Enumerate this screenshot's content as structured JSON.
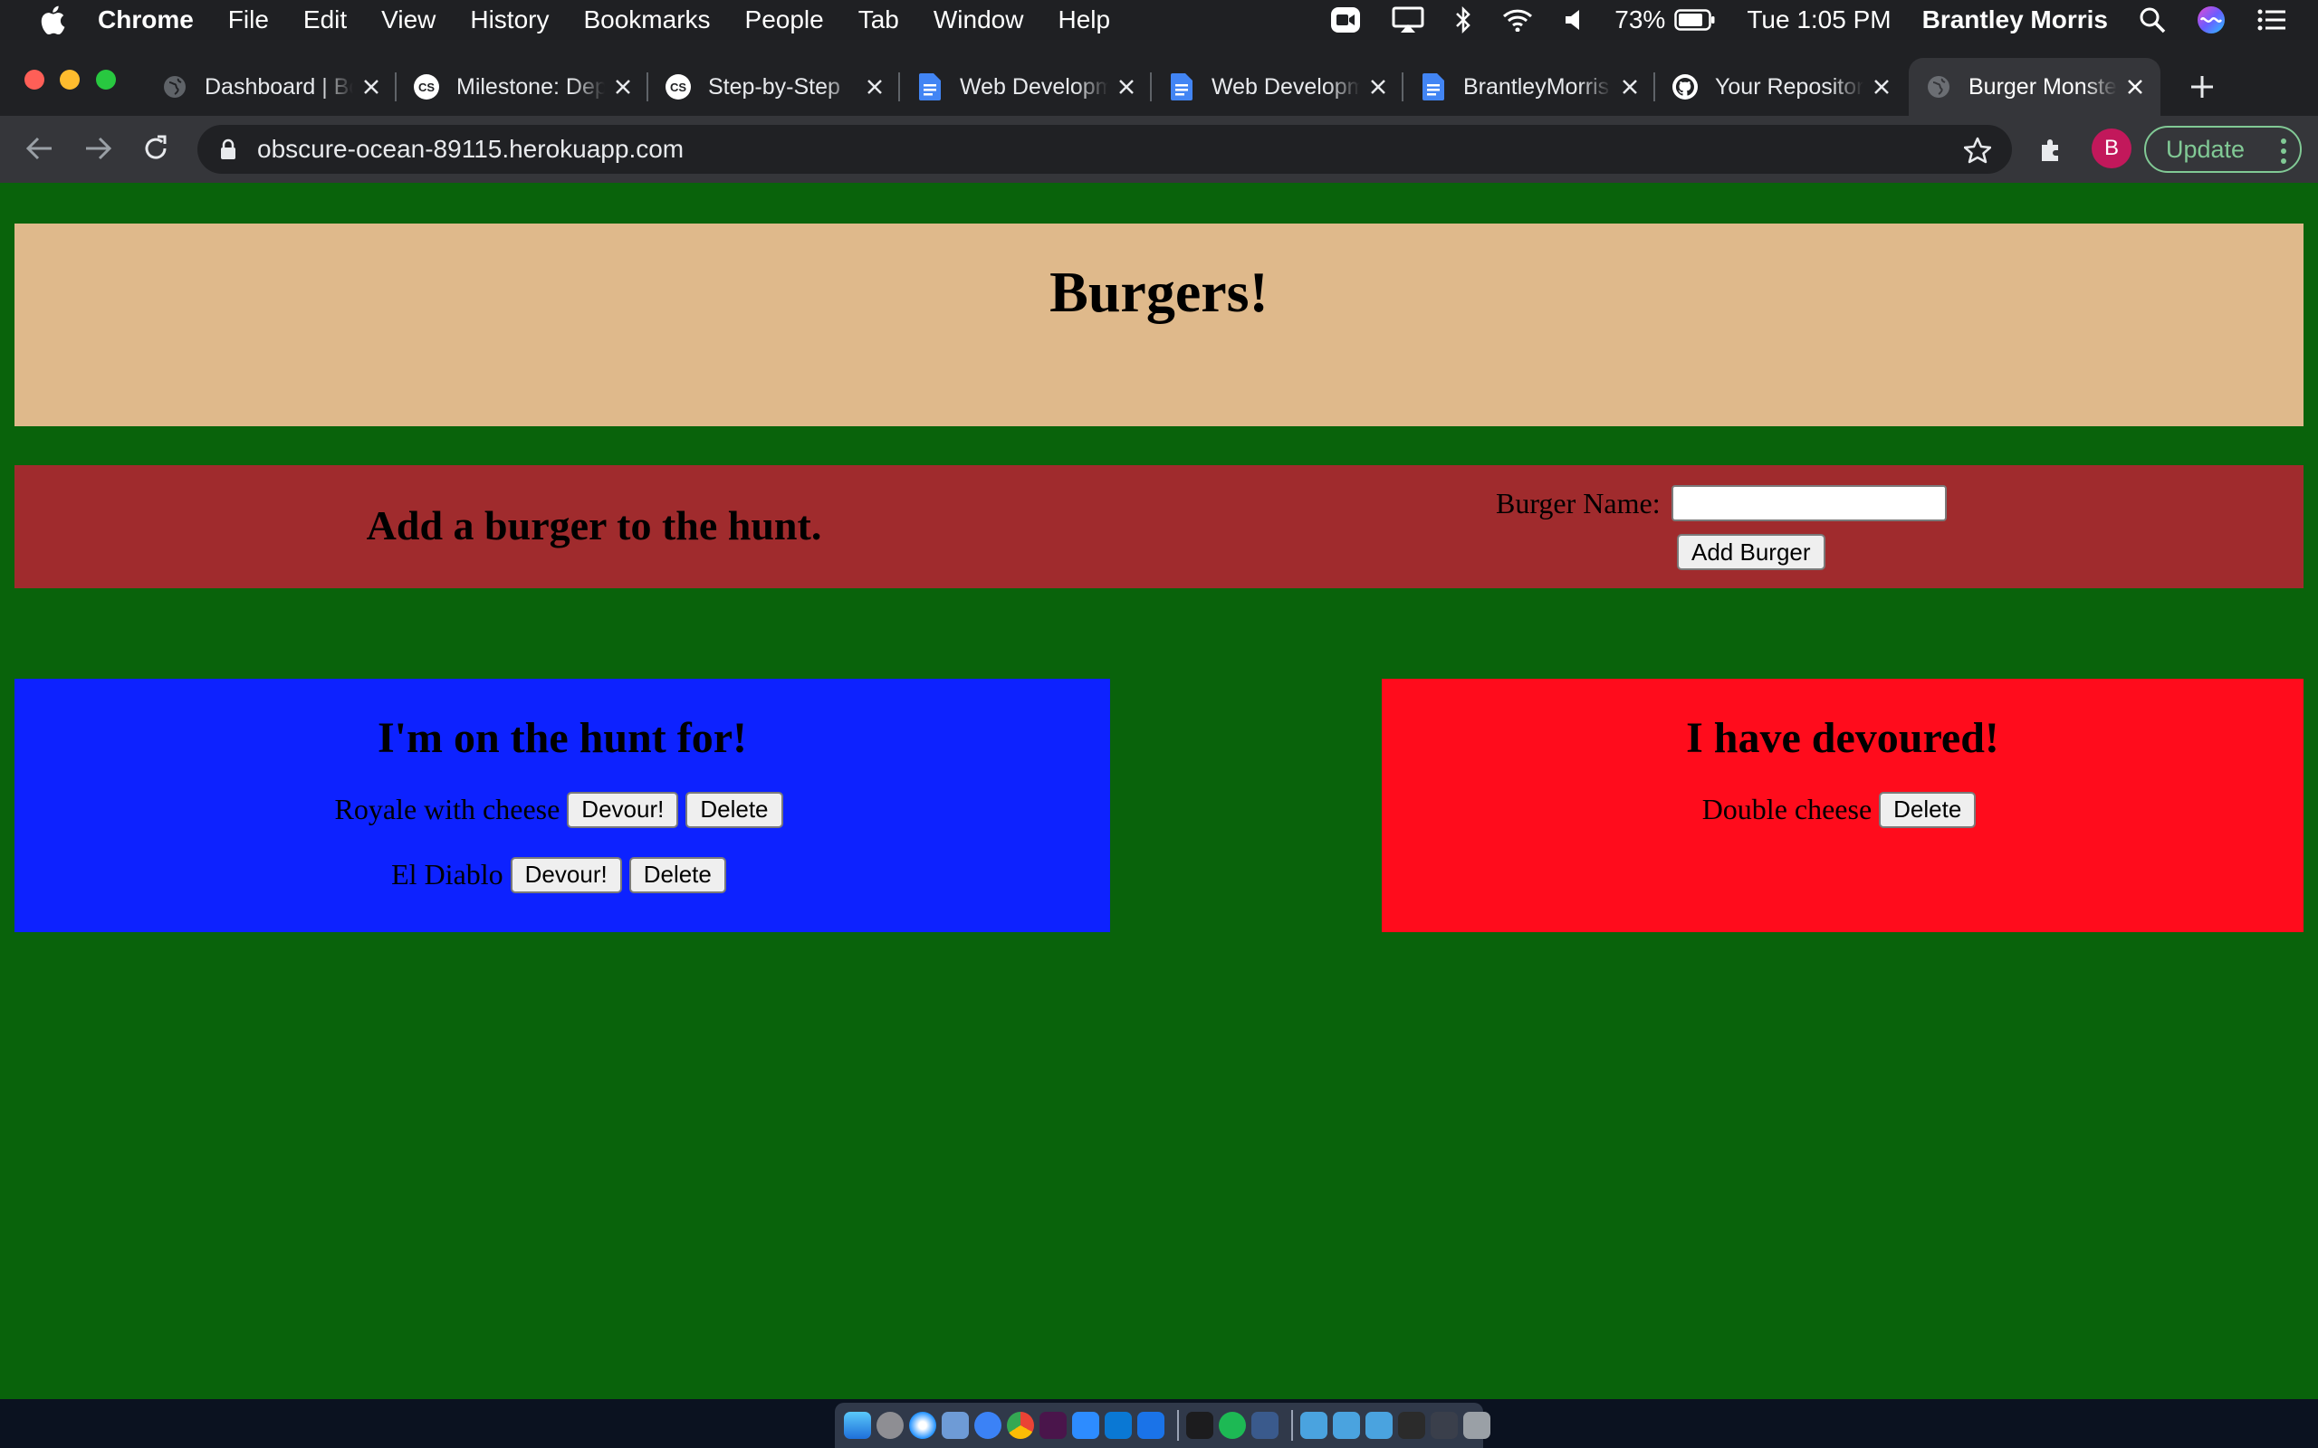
{
  "menubar": {
    "app_name": "Chrome",
    "items": [
      "File",
      "Edit",
      "View",
      "History",
      "Bookmarks",
      "People",
      "Tab",
      "Window",
      "Help"
    ],
    "battery": "73%",
    "clock": "Tue 1:05 PM",
    "user": "Brantley Morris"
  },
  "tabs": [
    {
      "title": "Dashboard | Bootcamp",
      "icon": "globe-icon",
      "active": false
    },
    {
      "title": "Milestone: Deploy",
      "icon": "codesignal-icon",
      "active": false
    },
    {
      "title": "Step-by-Step",
      "icon": "codesignal-icon",
      "active": false
    },
    {
      "title": "Web Development",
      "icon": "google-docs-icon",
      "active": false
    },
    {
      "title": "Web Development",
      "icon": "google-docs-icon",
      "active": false
    },
    {
      "title": "BrantleyMorris",
      "icon": "google-docs-icon",
      "active": false
    },
    {
      "title": "Your Repositories",
      "icon": "github-icon",
      "active": false
    },
    {
      "title": "Burger Monster",
      "icon": "globe-icon",
      "active": true
    }
  ],
  "toolbar": {
    "url": "obscure-ocean-89115.herokuapp.com",
    "update_label": "Update",
    "profile_initial": "B"
  },
  "page": {
    "title": "Burgers!",
    "add_section": {
      "heading": "Add a burger to the hunt.",
      "field_label": "Burger Name:",
      "field_value": "",
      "submit_label": "Add Burger"
    },
    "hunt": {
      "heading": "I'm on the hunt for!",
      "devour_label": "Devour!",
      "delete_label": "Delete",
      "items": [
        {
          "name": "Royale with cheese"
        },
        {
          "name": "El Diablo"
        }
      ]
    },
    "devoured": {
      "heading": "I have devoured!",
      "delete_label": "Delete",
      "items": [
        {
          "name": "Double cheese"
        }
      ]
    }
  },
  "colors": {
    "page_bg": "#09630b",
    "header_bg": "#dfb98b",
    "add_bg": "#a02b2d",
    "hunt_bg": "#0d22ff",
    "devoured_bg": "#ff0c1c"
  }
}
